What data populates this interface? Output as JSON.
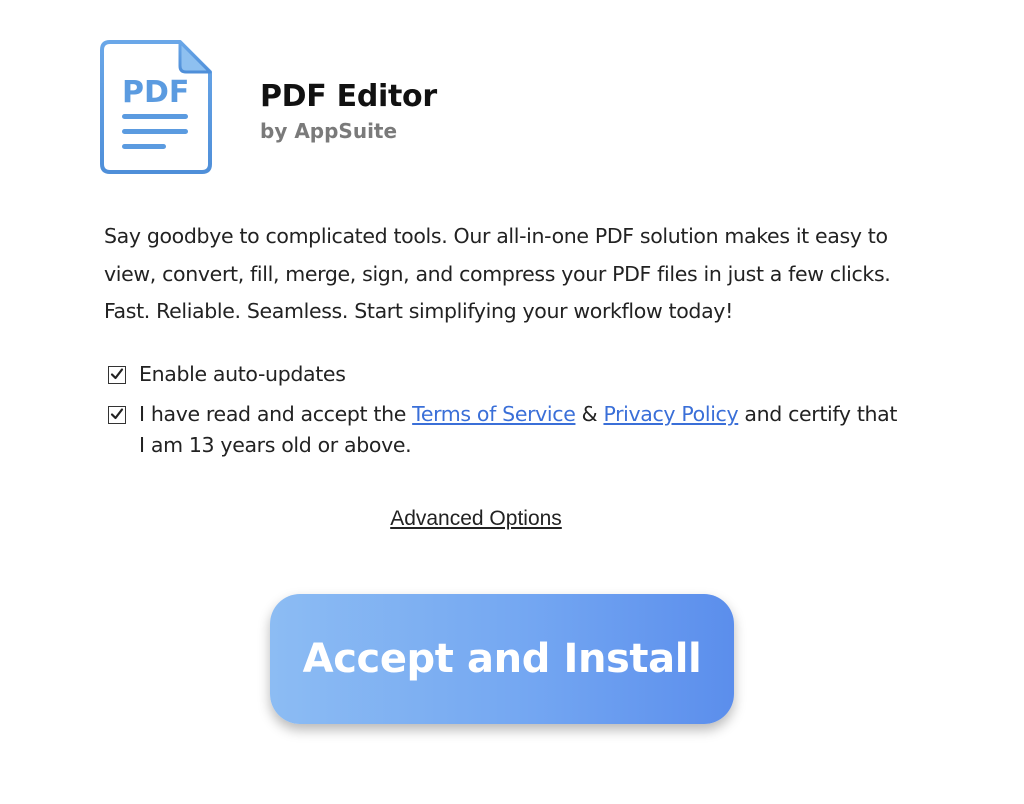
{
  "app": {
    "icon": "pdf-document-icon",
    "icon_text": "PDF",
    "title": "PDF Editor",
    "publisher": "by AppSuite"
  },
  "description": "Say goodbye to complicated tools. Our all-in-one PDF solution makes it easy to view, convert, fill, merge, sign, and compress your PDF files in just a few clicks. Fast. Reliable. Seamless. Start simplifying your workflow today!",
  "options": {
    "auto_updates": {
      "label": "Enable auto-updates",
      "checked": true
    },
    "terms": {
      "checked": true,
      "prefix": "I have read and accept the ",
      "terms_link": "Terms of Service",
      "joiner": " & ",
      "privacy_link": "Privacy Policy",
      "suffix": " and certify that I am 13 years old or above."
    }
  },
  "advanced_options_label": "Advanced Options",
  "install_button_label": "Accept and Install",
  "colors": {
    "link": "#3a6fd8",
    "button_gradient_start": "#8cbcf3",
    "button_gradient_end": "#5b8eec",
    "icon_blue": "#5b9be0",
    "publisher_gray": "#7a7a7a"
  }
}
